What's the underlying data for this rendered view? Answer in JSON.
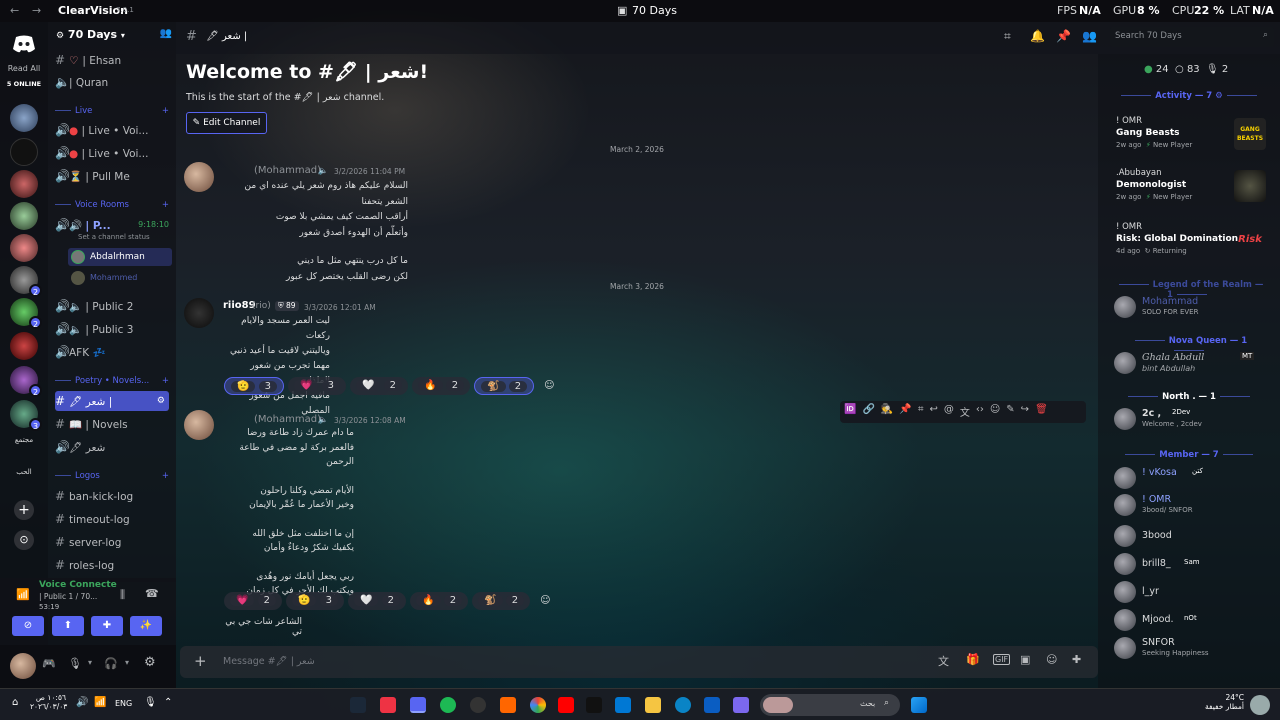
{
  "titlebar": {
    "app_name": "ClearVision",
    "app_version": "7.0.1",
    "window_title": "70 Days",
    "stats": {
      "fps_label": "FPS",
      "fps": "N/A",
      "gpu_label": "GPU",
      "gpu": "8 %",
      "cpu_label": "CPU",
      "cpu": "22 %",
      "lat_label": "LAT",
      "lat": "N/A"
    }
  },
  "rail": {
    "read_all": "Read All",
    "online": "5 ONLINE",
    "badges": [
      "2",
      "2",
      "2",
      "3"
    ],
    "text_server_1": "مجتمع",
    "text_server_2": "الحب"
  },
  "server": {
    "name": "70 Days"
  },
  "channels": {
    "top": [
      {
        "name": "| Ehsan"
      },
      {
        "name": "| Quran"
      }
    ],
    "live_category": "Live",
    "live": [
      {
        "name": "| Live • Voi..."
      },
      {
        "name": "| Live • Voi..."
      },
      {
        "name": "| Pull Me"
      }
    ],
    "voice_category": "Voice Rooms",
    "voice_active": {
      "name": "| P...",
      "timer": "9:18:10",
      "status": "Set a channel status"
    },
    "voice_users": [
      "Abdalrhman",
      "Mohammed"
    ],
    "voice_more": [
      {
        "name": "| Public 2"
      },
      {
        "name": "| Public 3"
      },
      {
        "name": "AFK"
      }
    ],
    "poetry_category": "Poetry • Novels...",
    "poetry": [
      {
        "name": "شعر |"
      },
      {
        "name": "| Novels"
      },
      {
        "name": "شعر"
      }
    ],
    "logos_category": "Logos",
    "logos": [
      {
        "name": "ban-kick-log"
      },
      {
        "name": "timeout-log"
      },
      {
        "name": "server-log"
      },
      {
        "name": "roles-log"
      }
    ]
  },
  "voice_connected": {
    "label": "Voice Connecte",
    "channel": "| Public 1 / 70...",
    "time": "53:19"
  },
  "topbar": {
    "channel": "شعر |",
    "search_placeholder": "Search 70 Days"
  },
  "chat": {
    "welcome_title": "Welcome to #🖋 | شعر!",
    "welcome_sub": "This is the start of the #🖋 | شعر channel.",
    "edit_button": "Edit Channel",
    "date_1": "March 2, 2026",
    "date_2": "March 3, 2026",
    "messages": [
      {
        "author": "(Mohammad)",
        "time": "3/2/2026 11:04 PM",
        "lines": [
          "السلام عليكم هاذ روم شعر يلي عنده اي من الشعر يتحفنا",
          "أراقب الصمت كيف يمشي بلا صوت",
          "وأتعلّم أن الهدوء أصدق شعور",
          "",
          "ما كل درب ينتهي مثل ما ديني",
          "لكن رضى القلب يختصر كل عبور"
        ]
      },
      {
        "author": "riio89",
        "nick": "(rio)",
        "tag": "89",
        "time": "3/3/2026 12:01 AM",
        "lines": [
          "ليت العمر مسجد والايام ركعات",
          "وياليتني لاقيت ما أعيد ذنبي",
          "مهما تجرب من شعور الملذات",
          "مافيه اجمل من شعور المصلي"
        ],
        "reactions": [
          {
            "emoji": "🫡",
            "count": "3"
          },
          {
            "emoji": "💗",
            "count": "3"
          },
          {
            "emoji": "🤍",
            "count": "2"
          },
          {
            "emoji": "🔥",
            "count": "2"
          },
          {
            "emoji": "🐒",
            "count": "2"
          }
        ]
      },
      {
        "author": "(Mohammad)",
        "time": "3/3/2026 12:08 AM",
        "lines": [
          "ما دام عمرك زاد طاعة ورضا",
          "فالعمر بركة لو مضى في طاعة الرحمن",
          "",
          "الأيام تمضي وكلنا راحلون",
          "وخير الأعمار ما عُمِّر بالإيمان",
          "",
          "إن ما اختلفت مثل خلق الله",
          "يكفيك شكرٌ ودعاءٌ وأمان",
          "",
          "ربي يجعل أيامك نور وهُدى",
          "ويكتب لك الأجر في كل زمان"
        ],
        "reactions": [
          {
            "emoji": "💗",
            "count": "2"
          },
          {
            "emoji": "🫡",
            "count": "3"
          },
          {
            "emoji": "🤍",
            "count": "2"
          },
          {
            "emoji": "🔥",
            "count": "2"
          },
          {
            "emoji": "🐒",
            "count": "2"
          }
        ]
      }
    ],
    "last_line": "الشاعر شات جي بي تي",
    "composer_placeholder": "Message #🖋 | شعر"
  },
  "members": {
    "counts": {
      "online": "24",
      "idle": "83",
      "other": "2"
    },
    "activity_label": "Activity — 7",
    "activities": [
      {
        "user": "! OMR",
        "game": "Gang Beasts",
        "when": "2w ago",
        "status": "New Player",
        "icon_text": "GANG BEASTS"
      },
      {
        "user": ".Abubayan",
        "game": "Demonologist",
        "when": "2w ago",
        "status": "New Player"
      },
      {
        "user": "! OMR",
        "game": "Risk: Global Domination",
        "when": "4d ago",
        "status": "Returning",
        "icon_text": "Risk"
      }
    ],
    "group_1": "Legend of the Realm — 1",
    "legend": {
      "name": "Mohammad",
      "status": "SOLO FOR EVER"
    },
    "group_2": "Nova Queen — 1",
    "nova": {
      "name": "Ghala Abdull",
      "tag": "MT",
      "status": "bint Abdullah"
    },
    "group_3": "North . — 1",
    "north": {
      "name": "2c ,",
      "tag": "2Dev",
      "status": "Welcome , 2cdev"
    },
    "group_4": "Member — 7",
    "member_list": [
      {
        "name": "! vKosa",
        "tag": "كتن"
      },
      {
        "name": "! OMR",
        "status": "3bood/ SNFOR"
      },
      {
        "name": "3bood"
      },
      {
        "name": "brill8_",
        "tag": "Sam"
      },
      {
        "name": "l_yr"
      },
      {
        "name": "Mjood.",
        "tag": "nOt"
      },
      {
        "name": "SNFOR",
        "status": "Seeking Happiness"
      }
    ]
  },
  "taskbar": {
    "time": "١٠:٥٦ ص",
    "date": "٢٠٢٦/٠٣/٠٣",
    "lang": "ENG",
    "search": "بحث",
    "temp": "24°C",
    "weather": "أمطار خفيفة"
  },
  "colors": {
    "accent": "#5865f2",
    "selected": "#4752c4",
    "online": "#3ba55c"
  }
}
